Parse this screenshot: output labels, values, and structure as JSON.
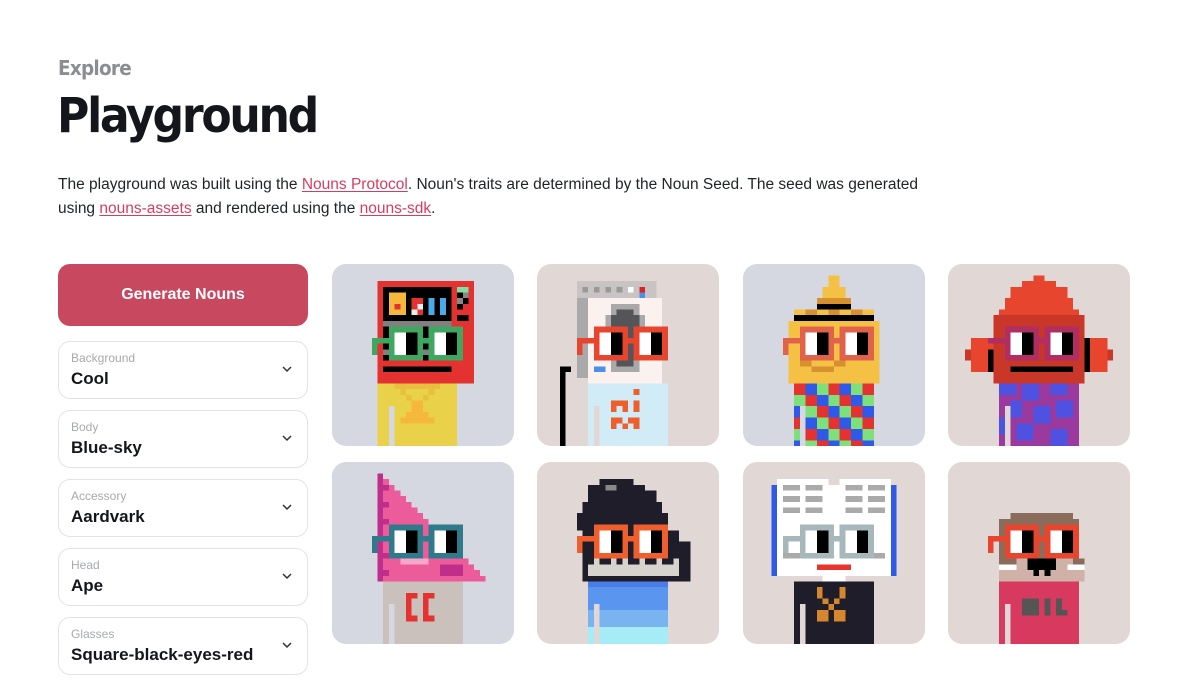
{
  "header": {
    "eyebrow": "Explore",
    "title": "Playground"
  },
  "intro": {
    "part1": "The playground was built using the ",
    "link1": "Nouns Protocol",
    "part2": ". Noun's traits are determined by the Noun Seed. The seed was generated using ",
    "link2": "nouns-assets",
    "part3": " and rendered using the ",
    "link3": "nouns-sdk",
    "part4": "."
  },
  "sidebar": {
    "generate_label": "Generate Nouns",
    "selects": [
      {
        "label": "Background",
        "value": "Cool"
      },
      {
        "label": "Body",
        "value": "Blue-sky"
      },
      {
        "label": "Accessory",
        "value": "Aardvark"
      },
      {
        "label": "Head",
        "value": "Ape"
      },
      {
        "label": "Glasses",
        "value": "Square-black-eyes-red"
      }
    ]
  },
  "colors": {
    "accent": "#c7485f",
    "link": "#d63c5e",
    "bg_cool": "#d5d7e1",
    "bg_warm": "#e1d7d5"
  },
  "nouns": [
    {
      "name": "noun-vending-machine",
      "background": "cool",
      "head": "vending-machine",
      "glasses": "green",
      "body": "yellow"
    },
    {
      "name": "noun-washing-machine",
      "background": "warm",
      "head": "washing-machine",
      "glasses": "red",
      "body": "light-blue"
    },
    {
      "name": "noun-sombrero",
      "background": "cool",
      "head": "sombrero",
      "glasses": "orange-red",
      "body": "checkers"
    },
    {
      "name": "noun-beanie",
      "background": "warm",
      "head": "beanie",
      "glasses": "magenta",
      "body": "purple-blue"
    },
    {
      "name": "noun-pyramid",
      "background": "cool",
      "head": "triangle-ruler",
      "glasses": "teal",
      "body": "gray"
    },
    {
      "name": "noun-piano",
      "background": "warm",
      "head": "piano",
      "glasses": "orange",
      "body": "blue-sky"
    },
    {
      "name": "noun-book",
      "background": "warm",
      "head": "book",
      "glasses": "gray",
      "body": "black"
    },
    {
      "name": "noun-otter",
      "background": "warm",
      "head": "otter",
      "glasses": "red",
      "body": "pink-red"
    }
  ]
}
